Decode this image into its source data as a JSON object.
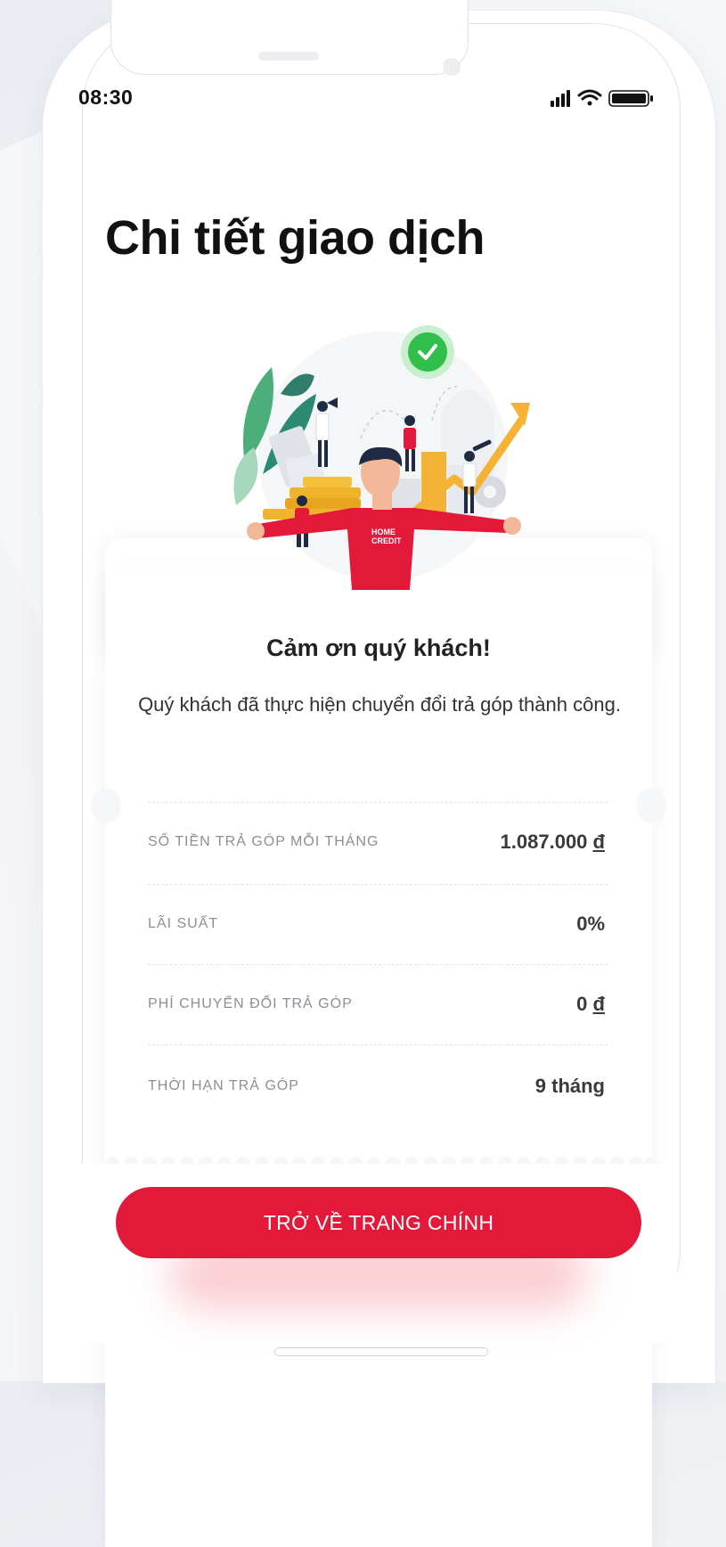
{
  "status_bar": {
    "time": "08:30"
  },
  "page": {
    "title": "Chi tiết giao dịch"
  },
  "illustration": {
    "shirt_text_line1": "HOME",
    "shirt_text_line2": "CREDIT"
  },
  "card": {
    "heading": "Cảm ơn quý khách!",
    "message": "Quý khách đã thực hiện chuyển đổi trả góp thành công.",
    "rows": [
      {
        "label": "SỐ TIỀN TRẢ GÓP MỖI THÁNG",
        "value": "1.087.000",
        "unit": "đ"
      },
      {
        "label": "LÃI SUẤT",
        "value": "0%",
        "unit": ""
      },
      {
        "label": "PHÍ CHUYỂN ĐỔI TRẢ GÓP",
        "value": "0",
        "unit": "đ"
      },
      {
        "label": "THỜI HẠN TRẢ GÓP",
        "value": "9 tháng",
        "unit": ""
      }
    ]
  },
  "actions": {
    "primary_label": "TRỞ VỀ TRANG CHÍNH"
  },
  "colors": {
    "brand_red": "#e3193a",
    "success_green": "#2fbf4a"
  },
  "icons": [
    "signal-icon",
    "wifi-icon",
    "battery-icon",
    "success-check-icon"
  ]
}
